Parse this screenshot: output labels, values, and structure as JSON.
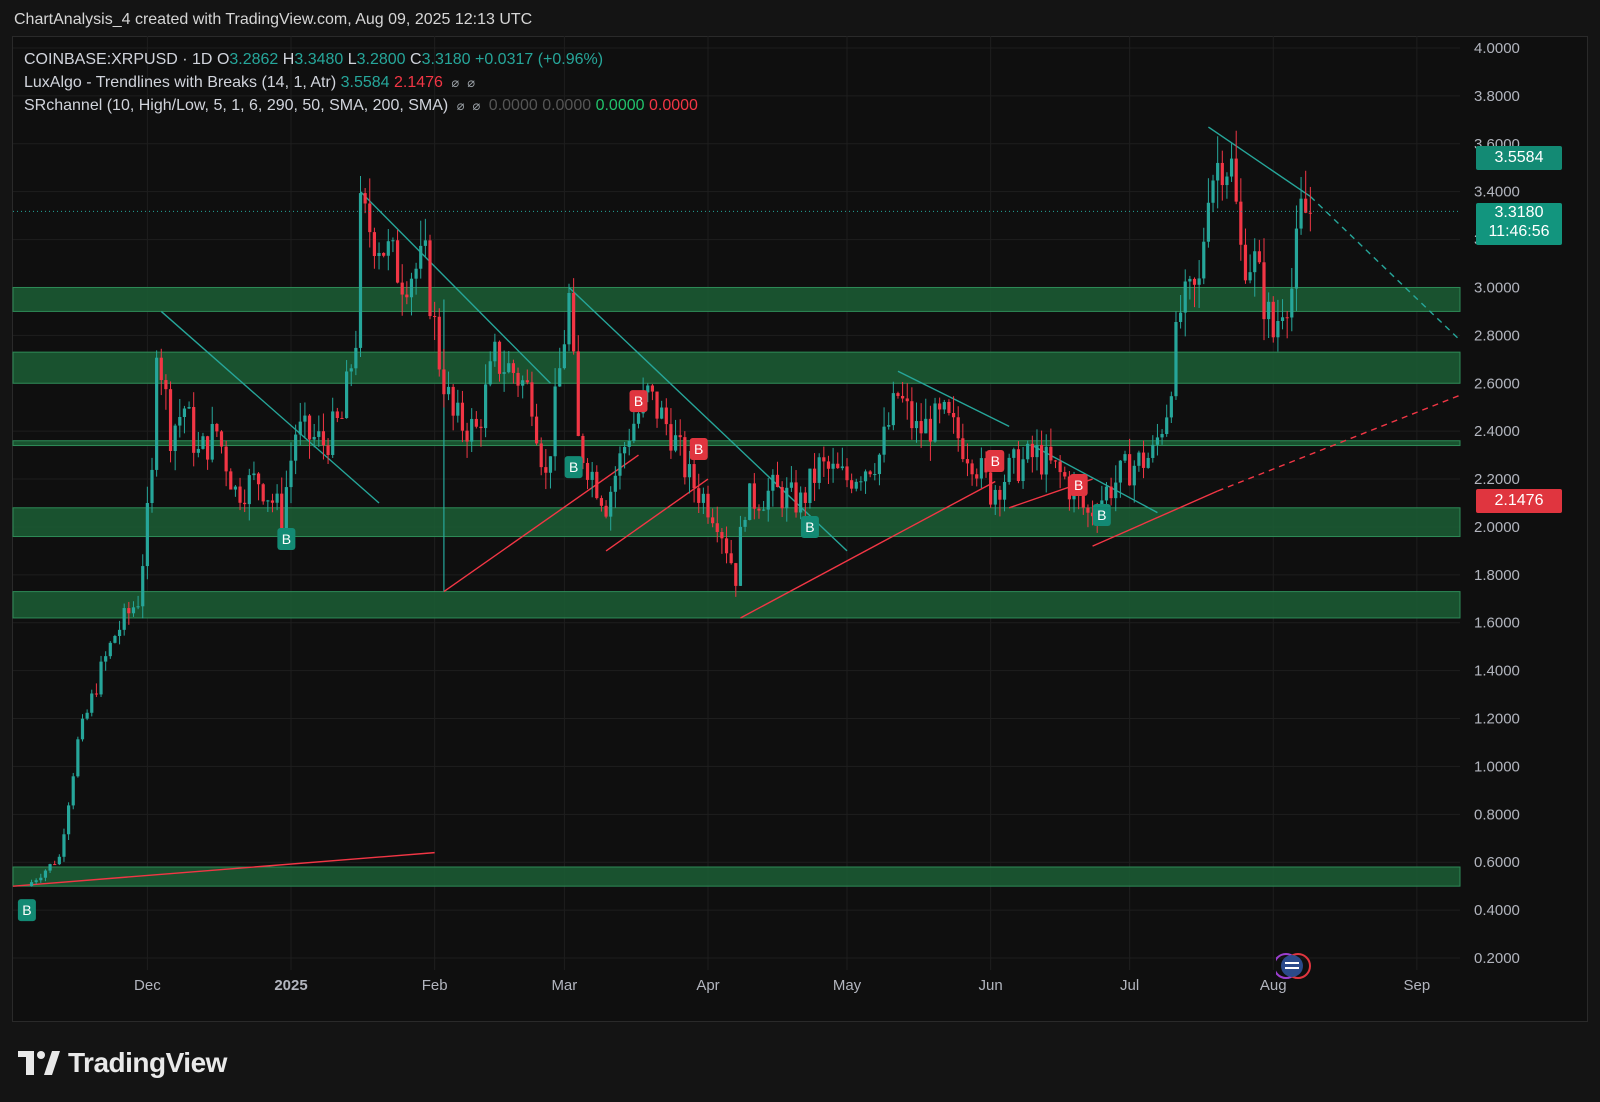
{
  "header": {
    "caption": "ChartAnalysis_4 created with TradingView.com, Aug 09, 2025 12:13 UTC"
  },
  "legend": {
    "symbol": "COINBASE:XRPUSD · 1D",
    "o_label": "O",
    "o_value": "3.2862",
    "h_label": "H",
    "h_value": "3.3480",
    "l_label": "L",
    "l_value": "3.2800",
    "c_label": "C",
    "c_value": "3.3180",
    "change": "+0.0317 (+0.96%)",
    "ind1_name": "LuxAlgo - Trendlines with Breaks (14, 1, Atr)",
    "ind1_v1": "3.5584",
    "ind1_v2": "2.1476",
    "ind2_name": "SRchannel (10, High/Low, 5, 1, 6, 290, 50, SMA, 200, SMA)",
    "ind2_v1": "0.0000",
    "ind2_v2": "0.0000",
    "ind2_v3": "0.0000",
    "ind2_v4": "0.0000",
    "eye_icon": "⌀"
  },
  "price_tags": {
    "upper_trend": "3.5584",
    "last_price": "3.3180",
    "countdown": "11:46:56",
    "lower_trend": "2.1476"
  },
  "colors": {
    "bull": "#26a69a",
    "bear": "#f23645",
    "zone": "#1b5e35",
    "zone_border": "#2e8b57",
    "bg": "#0f0f0f"
  },
  "brand": {
    "name": "TradingView"
  },
  "chart_data": {
    "type": "candlestick",
    "title": "COINBASE:XRPUSD · 1D",
    "x_ticks": [
      "Dec",
      "2025",
      "Feb",
      "Mar",
      "Apr",
      "May",
      "Jun",
      "Jul",
      "Aug",
      "Sep"
    ],
    "y_ticks": [
      "0.2000",
      "0.4000",
      "0.6000",
      "0.8000",
      "1.0000",
      "1.2000",
      "1.4000",
      "1.6000",
      "1.8000",
      "2.0000",
      "2.2000",
      "2.4000",
      "2.6000",
      "2.8000",
      "3.0000",
      "3.2000",
      "3.4000",
      "3.6000",
      "3.8000",
      "4.0000"
    ],
    "ylim": [
      0.2,
      4.0
    ],
    "grid": true,
    "last_close": 3.318,
    "sr_zones": [
      [
        0.5,
        0.58
      ],
      [
        1.62,
        1.73
      ],
      [
        1.96,
        2.08
      ],
      [
        2.34,
        2.36
      ],
      [
        2.6,
        2.73
      ],
      [
        2.9,
        3.0
      ]
    ],
    "trendline_values": {
      "upper": 3.5584,
      "lower": 2.1476
    },
    "path": [
      [
        "2024-11-05",
        0.5
      ],
      [
        "2024-11-12",
        0.62
      ],
      [
        "2024-11-16",
        1.1
      ],
      [
        "2024-11-21",
        1.4
      ],
      [
        "2024-11-24",
        1.55
      ],
      [
        "2024-11-29",
        1.7
      ],
      [
        "2024-12-02",
        2.2
      ],
      [
        "2024-12-03",
        2.8
      ],
      [
        "2024-12-06",
        2.4
      ],
      [
        "2024-12-09",
        2.5
      ],
      [
        "2024-12-12",
        2.3
      ],
      [
        "2024-12-16",
        2.4
      ],
      [
        "2024-12-20",
        2.15
      ],
      [
        "2024-12-25",
        2.2
      ],
      [
        "2024-12-30",
        2.05
      ],
      [
        "2025-01-02",
        2.4
      ],
      [
        "2025-01-08",
        2.35
      ],
      [
        "2025-01-12",
        2.45
      ],
      [
        "2025-01-15",
        2.8
      ],
      [
        "2025-01-16",
        3.3
      ],
      [
        "2025-01-20",
        3.2
      ],
      [
        "2025-01-25",
        3.05
      ],
      [
        "2025-01-30",
        3.1
      ],
      [
        "2025-02-02",
        2.7
      ],
      [
        "2025-02-05",
        2.45
      ],
      [
        "2025-02-10",
        2.4
      ],
      [
        "2025-02-14",
        2.7
      ],
      [
        "2025-02-18",
        2.65
      ],
      [
        "2025-02-22",
        2.55
      ],
      [
        "2025-02-25",
        2.2
      ],
      [
        "2025-03-02",
        2.95
      ],
      [
        "2025-03-04",
        2.35
      ],
      [
        "2025-03-10",
        2.1
      ],
      [
        "2025-03-15",
        2.4
      ],
      [
        "2025-03-19",
        2.55
      ],
      [
        "2025-03-24",
        2.4
      ],
      [
        "2025-03-28",
        2.2
      ],
      [
        "2025-04-03",
        2.05
      ],
      [
        "2025-04-07",
        1.8
      ],
      [
        "2025-04-09",
        2.1
      ],
      [
        "2025-04-15",
        2.15
      ],
      [
        "2025-04-21",
        2.1
      ],
      [
        "2025-04-25",
        2.25
      ],
      [
        "2025-05-01",
        2.2
      ],
      [
        "2025-05-08",
        2.3
      ],
      [
        "2025-05-12",
        2.55
      ],
      [
        "2025-05-16",
        2.4
      ],
      [
        "2025-05-22",
        2.45
      ],
      [
        "2025-05-28",
        2.3
      ],
      [
        "2025-06-01",
        2.15
      ],
      [
        "2025-06-06",
        2.25
      ],
      [
        "2025-06-11",
        2.3
      ],
      [
        "2025-06-17",
        2.2
      ],
      [
        "2025-06-22",
        2.05
      ],
      [
        "2025-06-26",
        2.15
      ],
      [
        "2025-07-01",
        2.25
      ],
      [
        "2025-07-06",
        2.3
      ],
      [
        "2025-07-09",
        2.5
      ],
      [
        "2025-07-12",
        2.9
      ],
      [
        "2025-07-16",
        3.0
      ],
      [
        "2025-07-18",
        3.45
      ],
      [
        "2025-07-21",
        3.55
      ],
      [
        "2025-07-23",
        3.5
      ],
      [
        "2025-07-25",
        3.15
      ],
      [
        "2025-07-28",
        3.1
      ],
      [
        "2025-08-01",
        2.8
      ],
      [
        "2025-08-03",
        2.95
      ],
      [
        "2025-08-05",
        3.0
      ],
      [
        "2025-08-07",
        3.3
      ],
      [
        "2025-08-09",
        3.32
      ]
    ],
    "break_signals": [
      {
        "date": "2024-11-05",
        "side": "bull",
        "label": "B"
      },
      {
        "date": "2024-12-31",
        "side": "bull",
        "label": "B"
      },
      {
        "date": "2025-03-03",
        "side": "bull",
        "label": "B"
      },
      {
        "date": "2025-03-17",
        "side": "bear",
        "label": "B"
      },
      {
        "date": "2025-03-30",
        "side": "bear",
        "label": "B"
      },
      {
        "date": "2025-04-23",
        "side": "bull",
        "label": "B"
      },
      {
        "date": "2025-06-02",
        "side": "bear",
        "label": "B"
      },
      {
        "date": "2025-06-20",
        "side": "bear",
        "label": "B"
      },
      {
        "date": "2025-06-25",
        "side": "bull",
        "label": "B"
      }
    ]
  }
}
